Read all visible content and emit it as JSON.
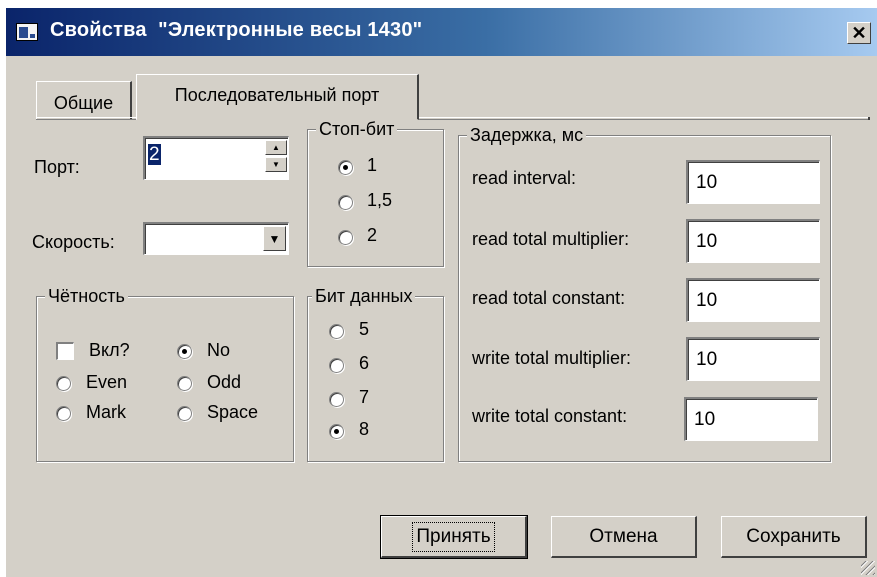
{
  "window": {
    "title": "Свойства  \"Электронные весы 1430\"",
    "close_label": "✕"
  },
  "tabs": [
    {
      "label": "Общие",
      "active": false
    },
    {
      "label": "Последовательный порт",
      "active": true
    }
  ],
  "port": {
    "label": "Порт:",
    "value": "2"
  },
  "speed": {
    "label": "Скорость:",
    "value": ""
  },
  "stop_bits": {
    "title": "Стоп-бит",
    "options": [
      "1",
      "1,5",
      "2"
    ],
    "selected": "1"
  },
  "parity": {
    "title": "Чётность",
    "enable_label": "Вкл?",
    "options": [
      "No",
      "Even",
      "Odd",
      "Mark",
      "Space"
    ],
    "selected": "No"
  },
  "data_bits": {
    "title": "Бит данных",
    "options": [
      "5",
      "6",
      "7",
      "8"
    ],
    "selected": "8"
  },
  "delay": {
    "title": "Задержка, мс",
    "fields": [
      {
        "label": "read interval:",
        "value": "10"
      },
      {
        "label": "read total multiplier:",
        "value": "10"
      },
      {
        "label": "read total constant:",
        "value": "10"
      },
      {
        "label": "write total multiplier:",
        "value": "10"
      },
      {
        "label": "write total constant:",
        "value": "10"
      }
    ]
  },
  "buttons": {
    "accept": "Принять",
    "cancel": "Отмена",
    "save": "Сохранить"
  },
  "colors": {
    "face": "#d4d0c8",
    "title_start": "#0a246a",
    "title_end": "#a6caf0"
  }
}
